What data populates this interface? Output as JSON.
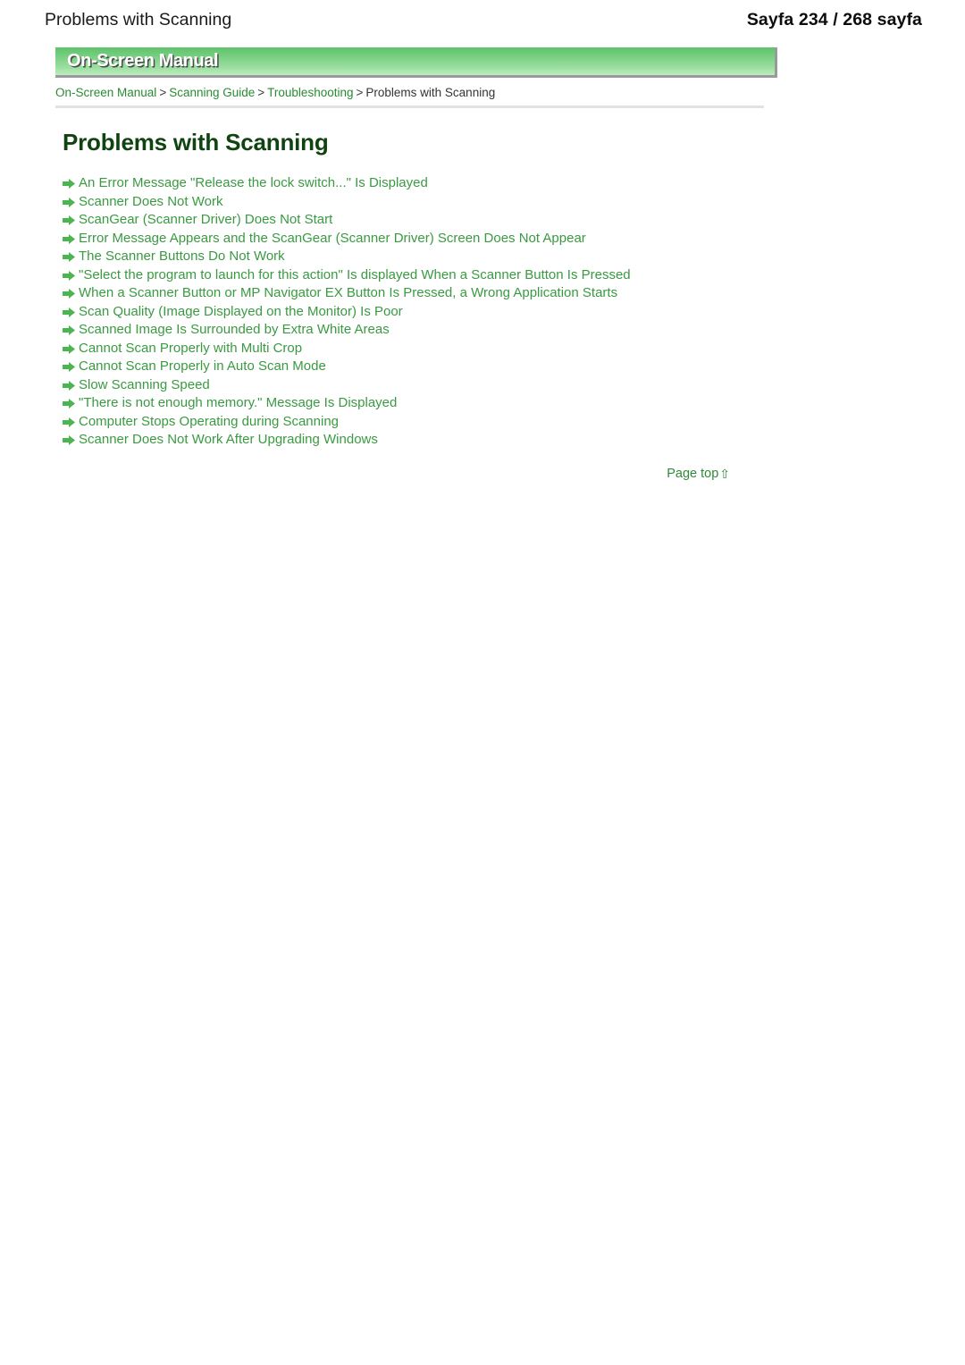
{
  "page_header": {
    "title": "Problems with Scanning",
    "page_info": "Sayfa 234 / 268 sayfa"
  },
  "banner": {
    "label": "On-Screen Manual",
    "gradient_top_color": "#5fc46a",
    "gradient_bottom_color": "#bfebc1",
    "border_color": "#9a9a9a"
  },
  "breadcrumb": {
    "items": [
      {
        "label": "On-Screen Manual",
        "current": false
      },
      {
        "label": "Scanning Guide",
        "current": false
      },
      {
        "label": "Troubleshooting",
        "current": false
      },
      {
        "label": "Problems with Scanning",
        "current": true
      }
    ],
    "separator": ">",
    "link_color": "#2a8a33",
    "current_color": "#333333"
  },
  "main": {
    "title": "Problems with Scanning",
    "title_color": "#0f4410",
    "link_color": "#3a9a41",
    "bullet_icon": "arrow-right-icon",
    "links": [
      "An Error Message \"Release the lock switch...\" Is Displayed",
      "Scanner Does Not Work",
      "ScanGear (Scanner Driver) Does Not Start",
      "Error Message Appears and the ScanGear (Scanner Driver) Screen Does Not Appear",
      "The Scanner Buttons Do Not Work",
      "\"Select the program to launch for this action\" Is displayed When a Scanner Button Is Pressed",
      "When a Scanner Button or MP Navigator EX Button Is Pressed, a Wrong Application Starts",
      "Scan Quality (Image Displayed on the Monitor) Is Poor",
      "Scanned Image Is Surrounded by Extra White Areas",
      "Cannot Scan Properly with Multi Crop",
      "Cannot Scan Properly in Auto Scan Mode",
      "Slow Scanning Speed",
      "\"There is not enough memory.\" Message Is Displayed",
      "Computer Stops Operating during Scanning",
      "Scanner Does Not Work After Upgrading Windows"
    ]
  },
  "footer": {
    "page_top_label": "Page top",
    "page_top_icon": "arrow-up-icon",
    "page_top_arrow_glyph": "⇧"
  }
}
